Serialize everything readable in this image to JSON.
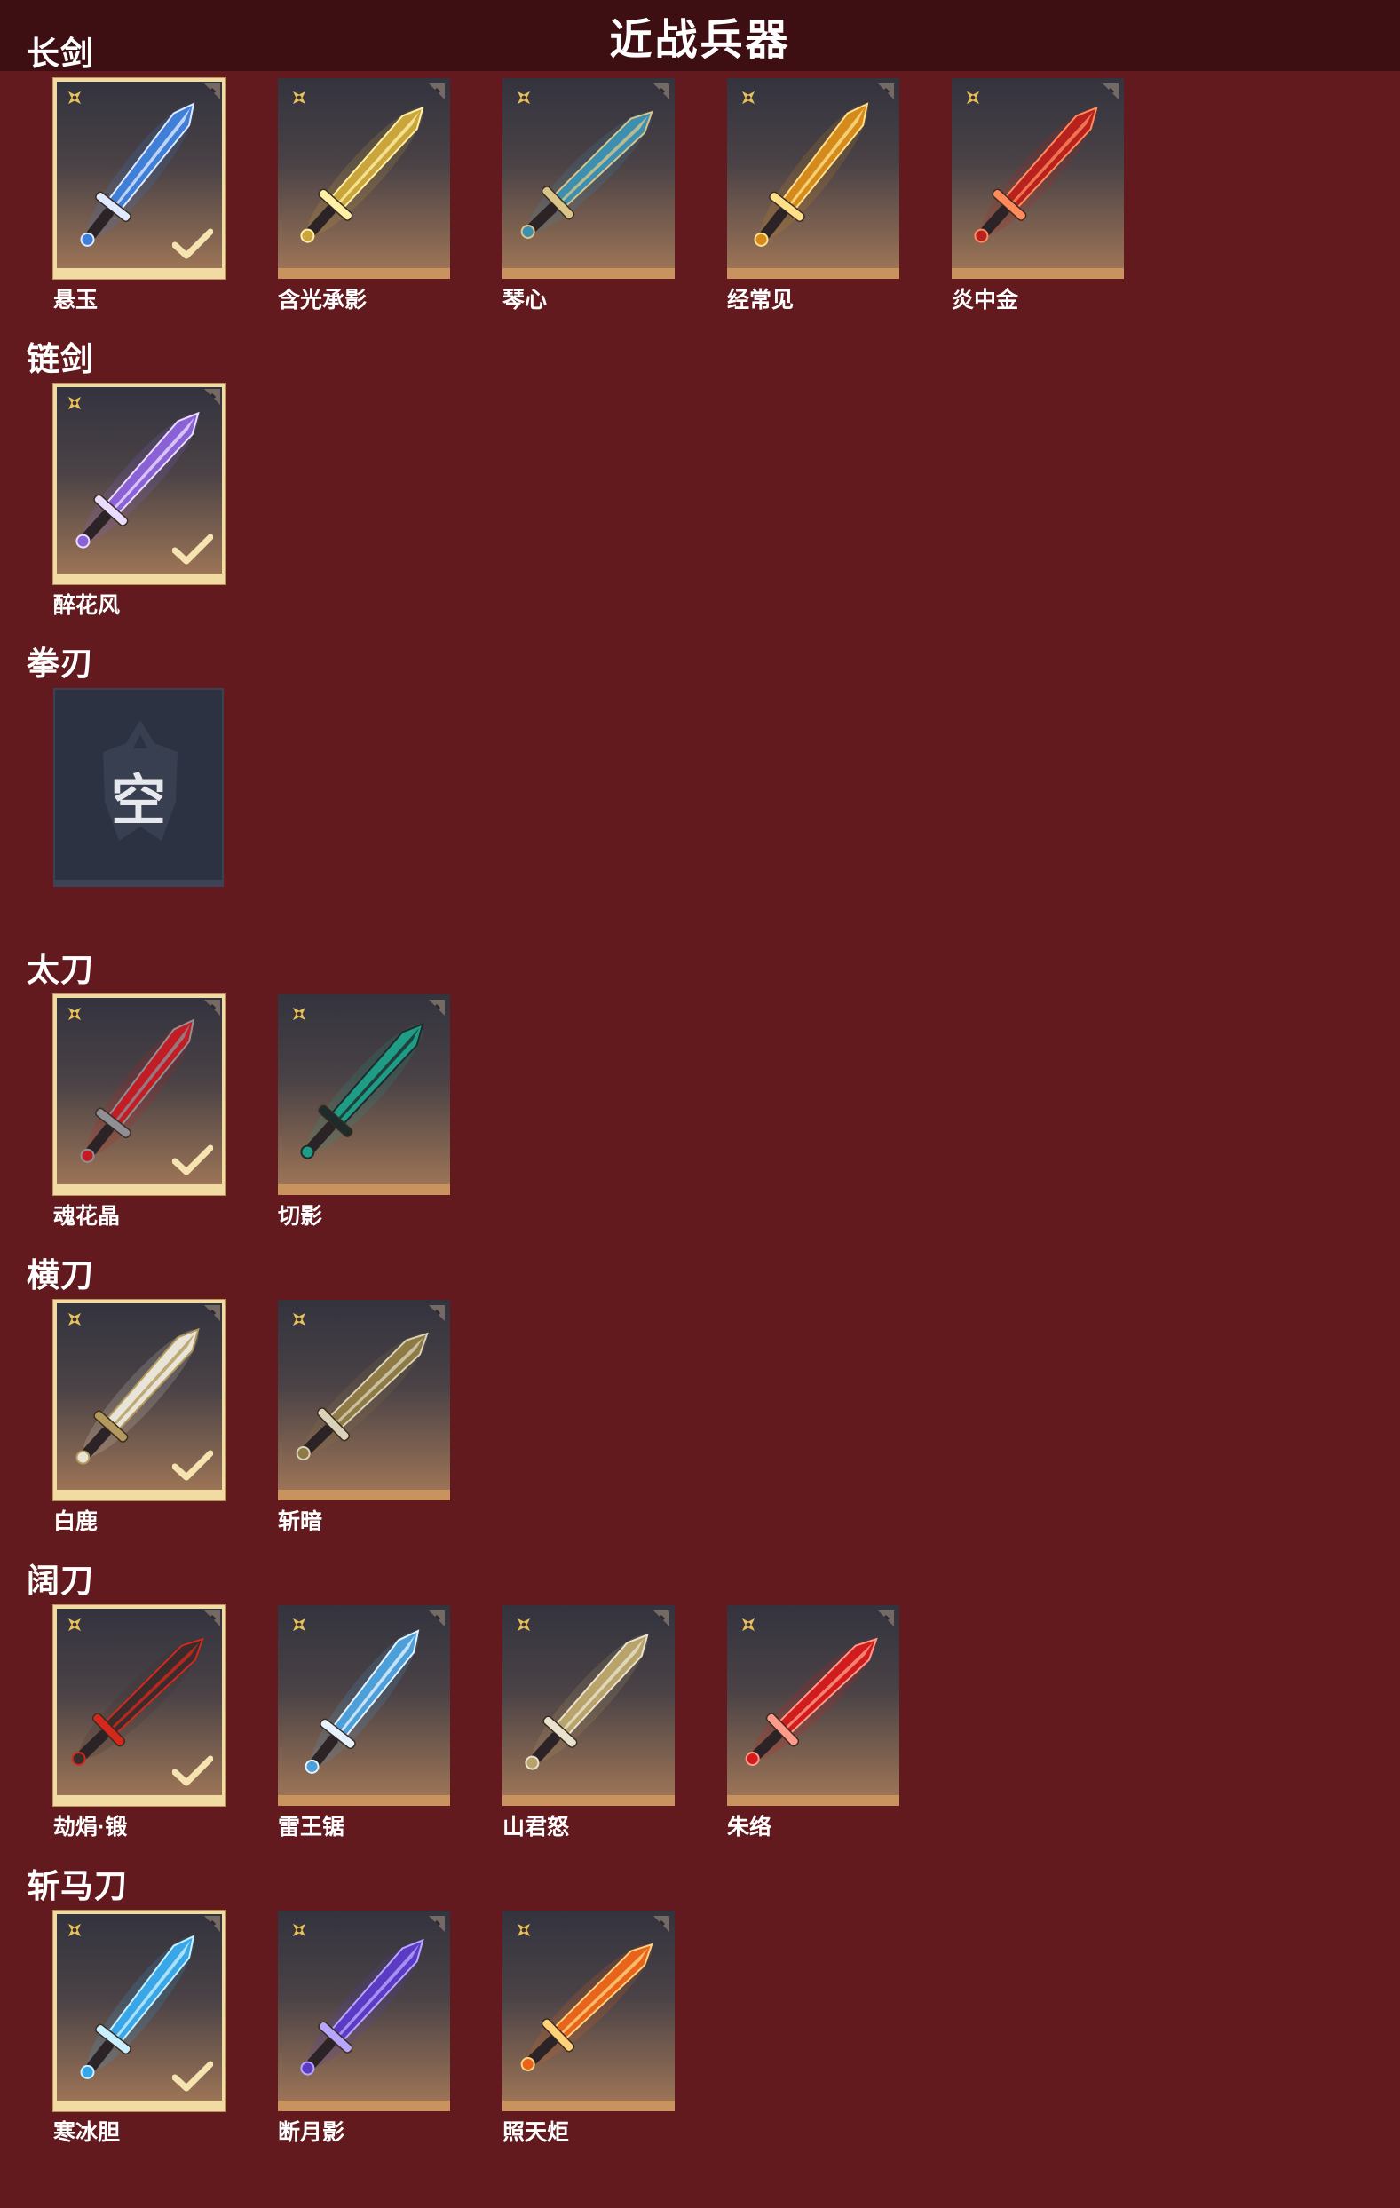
{
  "header": {
    "title": "近战兵器"
  },
  "categories": [
    {
      "title": "长剑",
      "items": [
        {
          "name": "悬玉",
          "equipped": true,
          "weapon_colors": [
            "#3f7fd8",
            "#dfe9ff"
          ]
        },
        {
          "name": "含光承影",
          "equipped": false,
          "weapon_colors": [
            "#c9a53b",
            "#fff0a6"
          ]
        },
        {
          "name": "琴心",
          "equipped": false,
          "weapon_colors": [
            "#3d8fb0",
            "#d9c48a"
          ]
        },
        {
          "name": "经常见",
          "equipped": false,
          "weapon_colors": [
            "#d58a1c",
            "#ffe08a"
          ]
        },
        {
          "name": "炎中金",
          "equipped": false,
          "weapon_colors": [
            "#b8221e",
            "#ff8a5c"
          ]
        }
      ]
    },
    {
      "title": "链剑",
      "items": [
        {
          "name": "醉花风",
          "equipped": true,
          "weapon_colors": [
            "#8a62d6",
            "#e9dcff"
          ]
        }
      ]
    },
    {
      "title": "拳刃",
      "items": [],
      "empty_label": "空"
    },
    {
      "title": "太刀",
      "items": [
        {
          "name": "魂花晶",
          "equipped": true,
          "weapon_colors": [
            "#c21d24",
            "#8f8f96"
          ]
        },
        {
          "name": "切影",
          "equipped": false,
          "weapon_colors": [
            "#1f9c86",
            "#1f2a2a"
          ]
        }
      ]
    },
    {
      "title": "横刀",
      "items": [
        {
          "name": "白鹿",
          "equipped": true,
          "weapon_colors": [
            "#e9e4d8",
            "#b39a5c"
          ]
        },
        {
          "name": "斩暗",
          "equipped": false,
          "weapon_colors": [
            "#8e7a45",
            "#d9d2b8"
          ]
        }
      ]
    },
    {
      "title": "阔刀",
      "items": [
        {
          "name": "劫焆·锻",
          "equipped": true,
          "weapon_colors": [
            "#3a2c2c",
            "#d4281c"
          ]
        },
        {
          "name": "雷王锯",
          "equipped": false,
          "weapon_colors": [
            "#4c9fd8",
            "#e6f3ff"
          ]
        },
        {
          "name": "山君怒",
          "equipped": false,
          "weapon_colors": [
            "#b8a36a",
            "#e9e2cf"
          ]
        },
        {
          "name": "朱络",
          "equipped": false,
          "weapon_colors": [
            "#d01c1c",
            "#ff9b8a"
          ]
        }
      ]
    },
    {
      "title": "斩马刀",
      "items": [
        {
          "name": "寒冰胆",
          "equipped": true,
          "weapon_colors": [
            "#39a6e8",
            "#c8f0ff"
          ]
        },
        {
          "name": "断月影",
          "equipped": false,
          "weapon_colors": [
            "#5b3bc4",
            "#b7a6ff"
          ]
        },
        {
          "name": "照天炬",
          "equipped": false,
          "weapon_colors": [
            "#e8631c",
            "#ffd27a"
          ]
        }
      ]
    }
  ],
  "colors": {
    "background": "#631a1e",
    "header_bg": "#3e0f12",
    "equipped_border": "#f2dba2",
    "card_bottom_bar": "#c8935e",
    "star_icon": "#e9c15a"
  }
}
